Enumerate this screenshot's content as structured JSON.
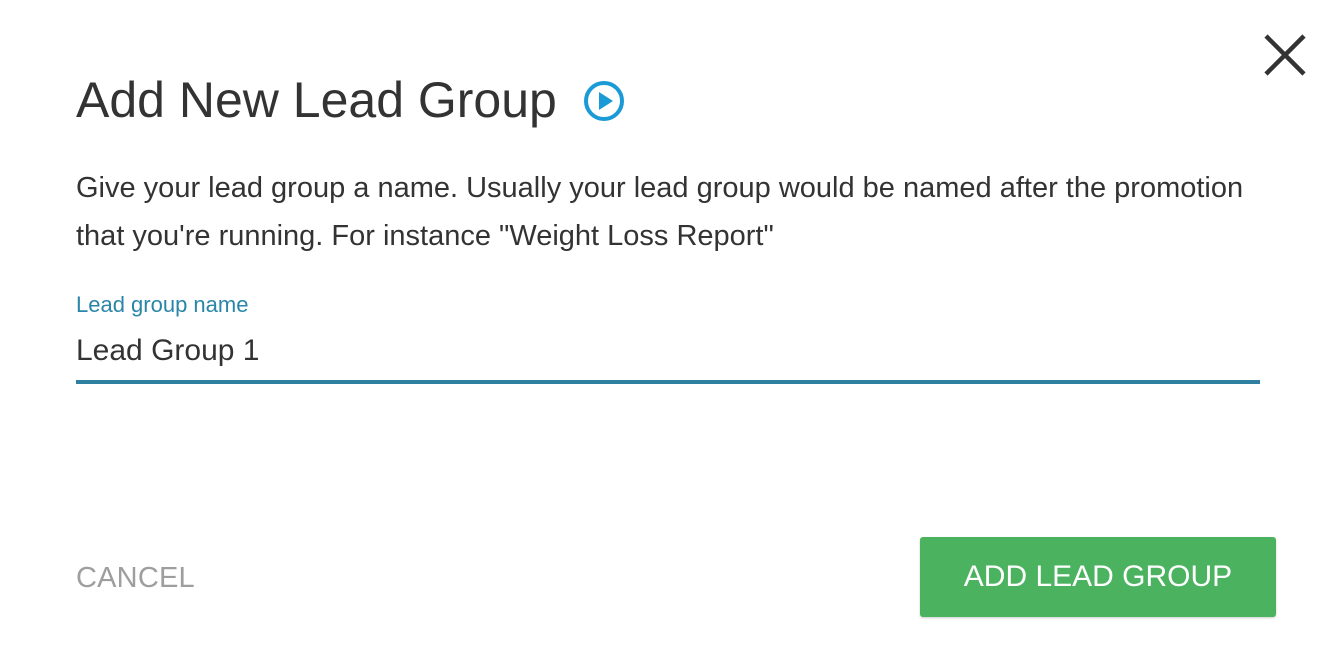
{
  "dialog": {
    "title": "Add New Lead Group",
    "description": "Give your lead group a name. Usually your lead group would be named after the promotion that you're running. For instance \"Weight Loss Report\"",
    "field": {
      "label": "Lead group name",
      "value": "Lead Group 1",
      "placeholder": ""
    },
    "cancel_label": "CANCEL",
    "submit_label": "ADD LEAD GROUP",
    "icons": {
      "close": "close-icon",
      "play": "play-circle-icon"
    }
  },
  "colors": {
    "accent": "#2a86a8",
    "primary_button": "#4bb35f",
    "play_icon": "#1a9ad6",
    "title_text": "#333333",
    "cancel_text": "#9e9e9e"
  }
}
